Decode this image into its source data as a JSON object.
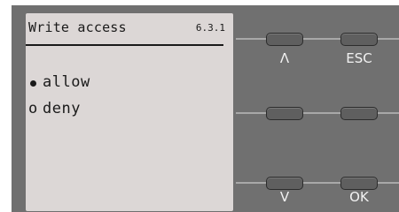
{
  "screen": {
    "title": "Write access",
    "code": "6.3.1",
    "options": [
      {
        "label": "allow",
        "selected": true
      },
      {
        "label": "deny",
        "selected": false
      }
    ],
    "unselected_marker": "o"
  },
  "keys": {
    "up_label": "Λ",
    "esc_label": "ESC",
    "down_label": "V",
    "ok_label": "OK"
  },
  "colors": {
    "lcd_background": "#dcd7d6",
    "panel": "#707070",
    "key": "#5f5f5f"
  }
}
